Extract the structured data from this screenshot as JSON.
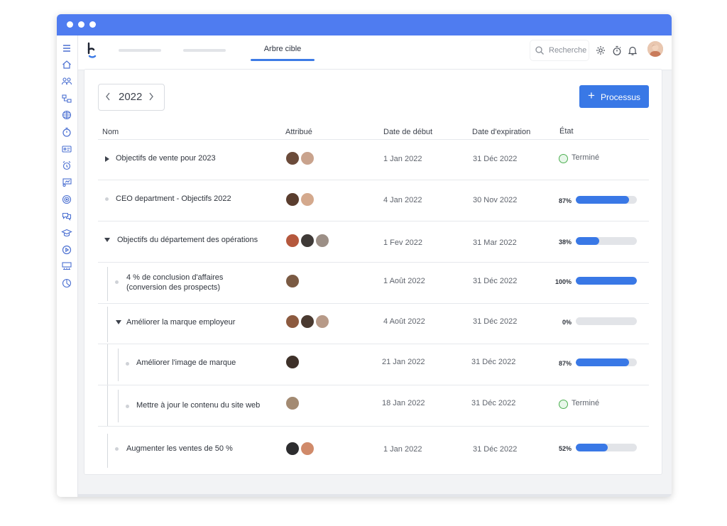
{
  "header": {
    "active_tab": "Arbre cible",
    "search_placeholder": "Recherche"
  },
  "toolbar": {
    "year": "2022",
    "new_label": "Processus"
  },
  "table": {
    "columns": [
      "Nom",
      "Attribué",
      "Date de début",
      "Date d'expiration",
      "État"
    ],
    "rows": [
      {
        "name": "Objectifs de vente pour 2023",
        "start": "1 Jan 2022",
        "end": "31 Déc 2022",
        "status": "Terminé",
        "progress": null
      },
      {
        "name": "CEO department - Objectifs 2022",
        "start": "4 Jan 2022",
        "end": "30 Nov 2022",
        "status": "87%",
        "progress": 0.87
      },
      {
        "name": "Objectifs du département des opérations",
        "start": "1 Fev 2022",
        "end": "31 Mar 2022",
        "status": "38%",
        "progress": 0.38
      },
      {
        "name_line1": "4 % de conclusion d'affaires",
        "name_line2": "(conversion des prospects)",
        "start": "1 Août 2022",
        "end": "31 Déc 2022",
        "status": "100%",
        "progress": 1.0
      },
      {
        "name": "Améliorer la marque employeur",
        "start": "4 Août 2022",
        "end": "31 Déc 2022",
        "status": "0%",
        "progress": 0.0
      },
      {
        "name": "Améliorer l'image de marque",
        "start": "21 Jan 2022",
        "end": "31 Déc 2022",
        "status": "87%",
        "progress": 0.87
      },
      {
        "name": "Mettre à jour le contenu du site web",
        "start": "18 Jan 2022",
        "end": "31 Déc 2022",
        "status": "Terminé",
        "progress": null
      },
      {
        "name": "Augmenter les ventes de 50 %",
        "start": "1 Jan 2022",
        "end": "31 Déc 2022",
        "status": "52%",
        "progress": 0.52
      }
    ]
  },
  "colors": {
    "accent": "#3978e6",
    "titlebar": "#4f7cf0",
    "done": "#4caf50",
    "notification": "#e53935"
  }
}
